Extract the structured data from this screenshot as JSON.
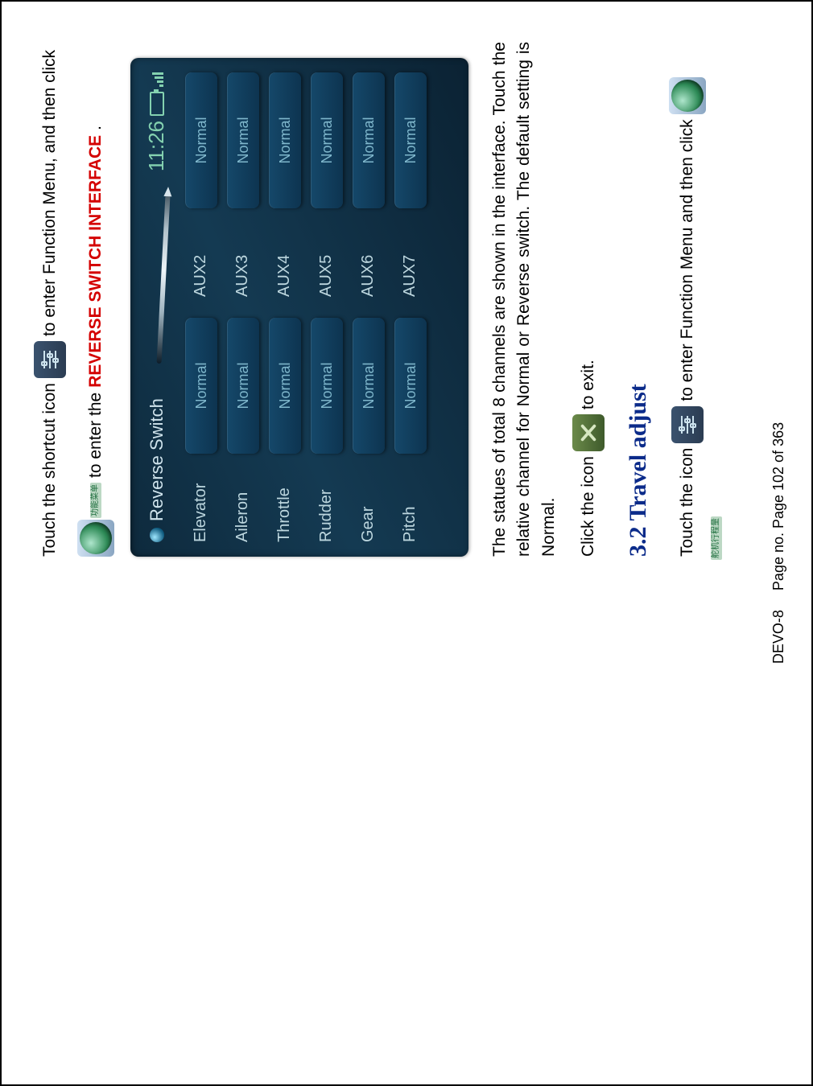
{
  "intro": {
    "part1": "Touch the shortcut icon",
    "part2": "to enter Function Menu, and then click",
    "part3": "to enter the",
    "part4_red": "REVERSE SWITCH INTERFACE",
    "part5_period": "."
  },
  "device": {
    "title": "Reverse Switch",
    "clock": "11:26",
    "button_label": "Normal",
    "left_channels": [
      "Elevator",
      "Aileron",
      "Throttle",
      "Rudder",
      "Gear",
      "Pitch"
    ],
    "right_channels": [
      "AUX2",
      "AUX3",
      "AUX4",
      "AUX5",
      "AUX6",
      "AUX7"
    ]
  },
  "paragraph": "The statues of total 8 channels are shown in the interface. Touch the relative channel for Normal or Reverse switch. The default setting is Normal.",
  "exit_line": {
    "before": "Click the icon",
    "after": "to exit."
  },
  "section_heading": "3.2 Travel adjust",
  "travel_line": {
    "before": "Touch the icon",
    "after": "to enter Function Menu and then click"
  },
  "icon_captions": {
    "function1": "功能菜单",
    "function2": "舵机行程量"
  },
  "footer": {
    "model": "DEVO-8",
    "page": "Page no. Page 102 of 363"
  }
}
